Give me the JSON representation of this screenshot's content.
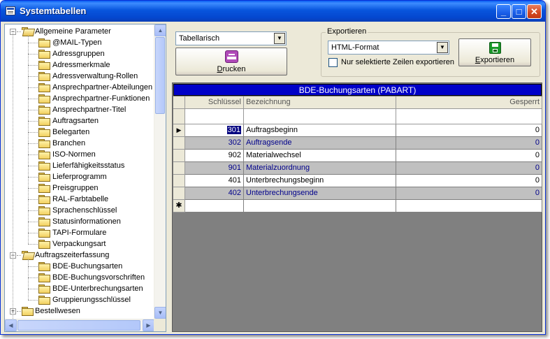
{
  "window": {
    "title": "Systemtabellen",
    "minimize": "_",
    "maximize": "□",
    "close": "✕"
  },
  "tree": {
    "groups": [
      {
        "label": "Allgemeine Parameter",
        "children": [
          "@MAIL-Typen",
          "Adressgruppen",
          "Adressmerkmale",
          "Adressverwaltung-Rollen",
          "Ansprechpartner-Abteilungen",
          "Ansprechpartner-Funktionen",
          "Ansprechpartner-Titel",
          "Auftragsarten",
          "Belegarten",
          "Branchen",
          "ISO-Normen",
          "Lieferfähigkeitsstatus",
          "Lieferprogramm",
          "Preisgruppen",
          "RAL-Farbtabelle",
          "Sprachenschlüssel",
          "Statusinformationen",
          "TAPI-Formulare",
          "Verpackungsart"
        ]
      },
      {
        "label": "Auftragszeiterfassung",
        "children": [
          "BDE-Buchungsarten",
          "BDE-Buchungsvorschriften",
          "BDE-Unterbrechungsarten",
          "Gruppierungsschlüssel"
        ]
      },
      {
        "label": "Bestellwesen",
        "children": []
      }
    ]
  },
  "toolbar": {
    "view_select": "Tabellarisch",
    "print_label_pre": "",
    "print_label_key": "D",
    "print_label_post": "rucken",
    "export_group": "Exportieren",
    "format_select": "HTML-Format",
    "selected_only_label": "Nur selektierte Zeilen exportieren",
    "selected_only_checked": false,
    "export_label_pre": "",
    "export_label_key": "E",
    "export_label_post": "xportieren",
    "accent_print": "#b04ab8",
    "accent_export": "#1a9a2a"
  },
  "grid": {
    "caption": "BDE-Buchungsarten (PABART)",
    "columns": [
      "Schlüssel",
      "Bezeichnung",
      "Gesperrt"
    ],
    "rows": [
      {
        "key": "301",
        "name": "Auftragsbeginn",
        "locked": "0"
      },
      {
        "key": "302",
        "name": "Auftragsende",
        "locked": "0"
      },
      {
        "key": "902",
        "name": "Materialwechsel",
        "locked": "0"
      },
      {
        "key": "901",
        "name": "Materialzuordnung",
        "locked": "0"
      },
      {
        "key": "401",
        "name": "Unterbrechungsbeginn",
        "locked": "0"
      },
      {
        "key": "402",
        "name": "Unterbrechungsende",
        "locked": "0"
      }
    ],
    "current_row_marker": "▶",
    "new_row_marker": "✱"
  }
}
